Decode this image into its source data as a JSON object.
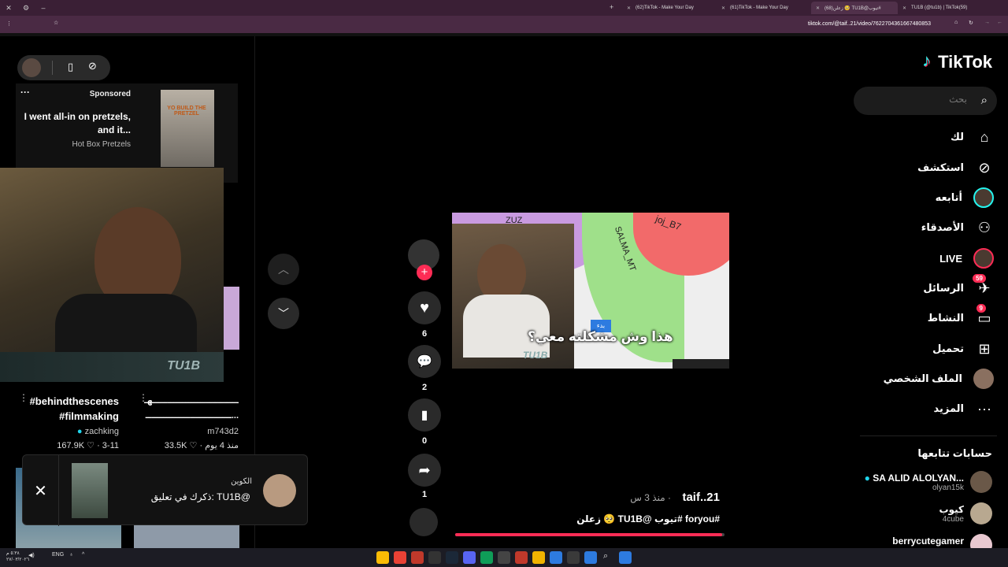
{
  "browser": {
    "tabs": [
      {
        "label": "(62)TikTok - Make Your Day",
        "active": false
      },
      {
        "label": "(61)TikTok - Make Your Day",
        "active": false
      },
      {
        "label": "(68)زعلن 🥺 TU1B@تيوب#",
        "active": true
      },
      {
        "label": "TU1B (@tu1b) | TikTok(59)",
        "active": false
      }
    ],
    "url": "tiktok.com/@taif..21/video/7622704361667480853"
  },
  "left_feed": {
    "ad": {
      "sponsored": "Sponsored",
      "headline": "I went all-in on pretzels, and it...",
      "brand": "Hot Box Pretzels",
      "thumb_text": "YO BUILD THE PRETZEL"
    },
    "webcam_tag": "TU1B",
    "videos": [
      {
        "caption": "#behindthescenes #filmmaking",
        "author": "zachking",
        "verified": true,
        "likes": "167.9K",
        "date": "3-11"
      },
      {
        "caption": "ـــــــــــــــــــــــــــــهـ ...ـــــــــــــــــــــــــــــ",
        "author": "m743d2",
        "verified": false,
        "likes": "33.5K",
        "date": "منذ 4 يوم"
      }
    ]
  },
  "toast": {
    "name": "الكوين",
    "message": "ذكرك في تعليق: TU1B@",
    "close": "✕"
  },
  "actions": {
    "likes": "6",
    "comments": "2",
    "saves": "0",
    "shares": "1"
  },
  "video": {
    "wheel_labels": [
      "joj_B7",
      "SALMA_MT",
      "ZUZ"
    ],
    "start_button": "بدء",
    "subtitle": "هذا وش مشكلته معي؟",
    "inset_tag": "TU1B",
    "username": "taif..21",
    "time": "منذ 3 س ·",
    "caption": "زعلن 🥺 TU1B@ تيوب# foryou#",
    "progress": 0.99
  },
  "sidebar": {
    "logo": "TikTok",
    "search_placeholder": "بحث",
    "nav": [
      {
        "label": "لك",
        "icon": "home-icon"
      },
      {
        "label": "استكشف",
        "icon": "compass-icon"
      },
      {
        "label": "أتابعه",
        "icon": "following-avatar"
      },
      {
        "label": "الأصدقاء",
        "icon": "friends-icon"
      },
      {
        "label": "LIVE",
        "icon": "live-avatar"
      },
      {
        "label": "الرسائل",
        "icon": "send-icon",
        "badge": "59"
      },
      {
        "label": "النشاط",
        "icon": "activity-icon",
        "badge": "9"
      },
      {
        "label": "تحميل",
        "icon": "upload-icon"
      },
      {
        "label": "الملف الشخصي",
        "icon": "profile-avatar"
      },
      {
        "label": "المزيد",
        "icon": "more-icon"
      }
    ],
    "following_title": "حسابات تتابعها",
    "following": [
      {
        "name": "SA ALID ALOLYAN...",
        "handle": "olyan15k",
        "verified": true
      },
      {
        "name": "كيوب",
        "handle": "4cube",
        "verified": false
      },
      {
        "name": "berrycutegamer",
        "handle": "",
        "verified": false
      }
    ]
  },
  "taskbar": {
    "lang": "ENG",
    "time": "٥:٣٨ م",
    "date": "٢٧/٠٣/٢٠٢٦"
  }
}
